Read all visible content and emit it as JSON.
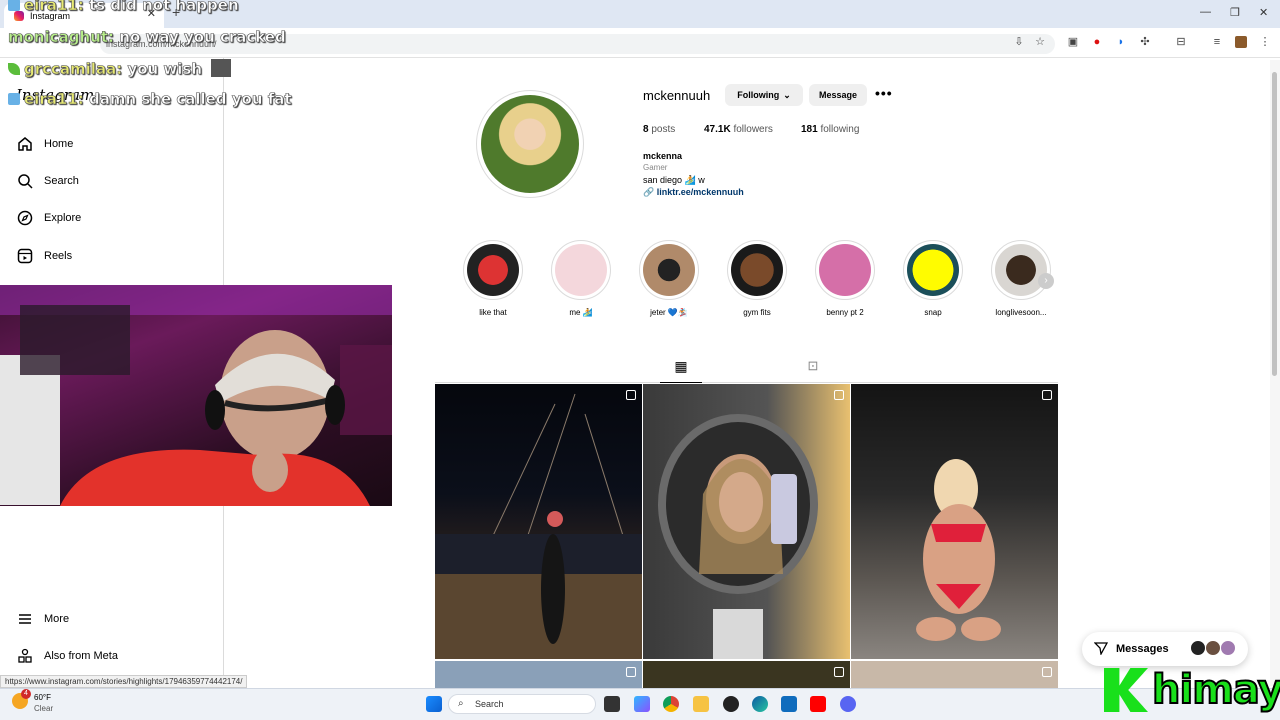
{
  "browser": {
    "tab_title": "Instagram",
    "url": "instagram.com/mckennuuh/",
    "status_url": "https://www.instagram.com/stories/highlights/17946359774442174/"
  },
  "chat": [
    {
      "user": "eira11:",
      "msg": "ts did not happen"
    },
    {
      "user": "monicaghut:",
      "msg": "no way you cracked"
    },
    {
      "user": "grccamilaa:",
      "msg": "you wish"
    },
    {
      "user": "eira11:",
      "msg": "damn she called you fat"
    }
  ],
  "sidebar": {
    "logo": "Instagram",
    "items": [
      {
        "label": "Home",
        "icon": "home-icon"
      },
      {
        "label": "Search",
        "icon": "search-icon"
      },
      {
        "label": "Explore",
        "icon": "explore-icon"
      },
      {
        "label": "Reels",
        "icon": "reels-icon"
      }
    ],
    "more": "More",
    "meta": "Also from Meta"
  },
  "profile": {
    "username": "mckennuuh",
    "following_btn": "Following",
    "message_btn": "Message",
    "posts_count": "8",
    "posts_label": "posts",
    "followers_count": "47.1K",
    "followers_label": "followers",
    "following_count": "181",
    "following_label": "following",
    "bio_name": "mckenna",
    "bio_category": "Gamer",
    "bio_text": "san diego 🏄 w",
    "bio_link": "linktr.ee/mckennuuh"
  },
  "highlights": [
    {
      "label": "like that"
    },
    {
      "label": "me 🏄"
    },
    {
      "label": "jeter 💙🏂"
    },
    {
      "label": "gym fits"
    },
    {
      "label": "benny pt 2"
    },
    {
      "label": "snap"
    },
    {
      "label": "longlivesoon..."
    }
  ],
  "messages": {
    "label": "Messages"
  },
  "taskbar": {
    "weather_temp": "60°F",
    "weather_desc": "Clear",
    "search_placeholder": "Search",
    "badge": "4"
  },
  "watermark": "himay",
  "colors": {
    "accent": "#0095f6",
    "link": "#00376b",
    "watermark": "#19e01b"
  }
}
